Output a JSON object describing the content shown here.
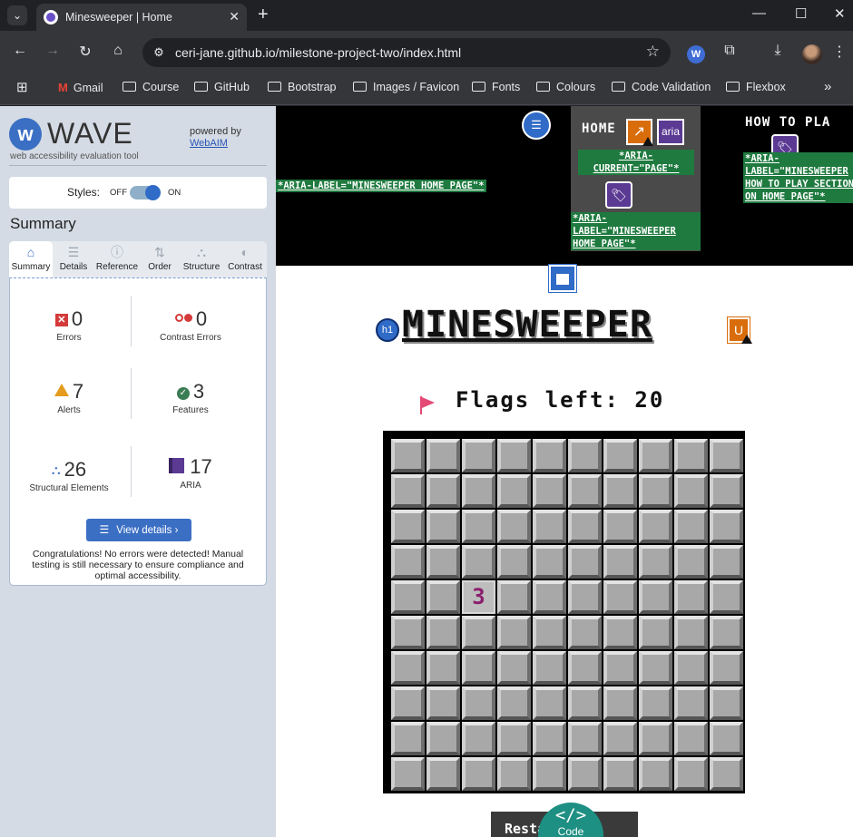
{
  "browser": {
    "tab_title": "Minesweeper | Home",
    "url": "ceri-jane.github.io/milestone-project-two/index.html",
    "bookmarks": [
      "Gmail",
      "Course",
      "GitHub",
      "Bootstrap",
      "Images / Favicon",
      "Fonts",
      "Colours",
      "Code Validation",
      "Flexbox"
    ]
  },
  "wave": {
    "logo_text": "WAVE",
    "subtitle": "web accessibility evaluation tool",
    "powered_by": "powered by",
    "webaim": "WebAIM",
    "styles_label": "Styles:",
    "styles_off": "OFF",
    "styles_on": "ON",
    "summary_title": "Summary",
    "tabs": [
      "Summary",
      "Details",
      "Reference",
      "Order",
      "Structure",
      "Contrast"
    ],
    "stats": {
      "errors": {
        "value": "0",
        "label": "Errors"
      },
      "contrast": {
        "value": "0",
        "label": "Contrast Errors"
      },
      "alerts": {
        "value": "7",
        "label": "Alerts"
      },
      "features": {
        "value": "3",
        "label": "Features"
      },
      "structural": {
        "value": "26",
        "label": "Structural Elements"
      },
      "aria": {
        "value": "17",
        "label": "ARIA"
      }
    },
    "view_details": "View details ›",
    "congrats": "Congratulations! No errors were detected! Manual testing is still necessary to ensure compliance and optimal accessibility."
  },
  "page": {
    "aria_left": "*ARIA-LABEL=\"MINESWEEPER HOME PAGE\"*",
    "home_label": "HOME",
    "aria_badge": "aria",
    "home_aria_current": "*ARIA-CURRENT=\"PAGE\"*",
    "home_aria_label": "*ARIA-LABEL=\"MINESWEEPER HOME PAGE\"*",
    "howto_label": "HOW TO PLA",
    "howto_aria": "*ARIA-LABEL=\"MINESWEEPER HOW TO PLAY SECTION ON HOME PAGE\"*",
    "h1_badge": "h1",
    "title": "MINESWEEPER",
    "u_badge": "U",
    "flags_text": "Flags left: 20",
    "revealed_cell": "3",
    "restart_label": "Restart Game",
    "code_label": "Code"
  },
  "colors": {
    "wave_blue": "#3b6fc4",
    "aria_green": "#1f7a3f",
    "aria_purple": "#5b3a93",
    "alert_orange": "#d96d0b"
  }
}
